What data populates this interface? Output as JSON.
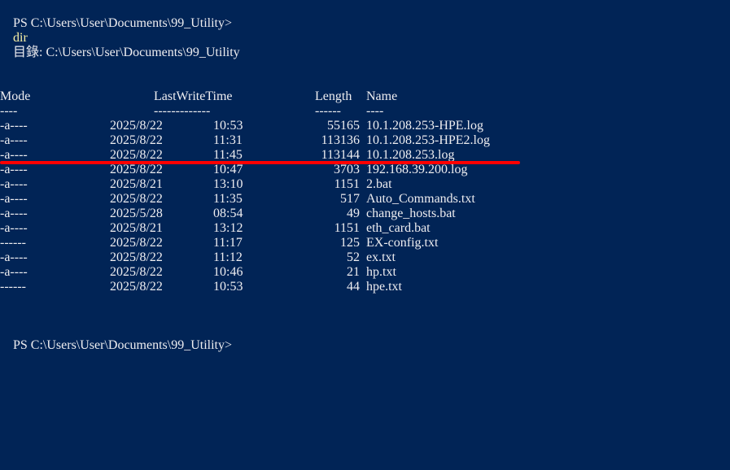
{
  "prompt_top": {
    "prefix": "PS C:\\Users\\User\\Documents\\99_Utility>",
    "command": "dir"
  },
  "directory_label": "    目錄: C:\\Users\\User\\Documents\\99_Utility",
  "headers": {
    "mode": "Mode",
    "last_write_time": "LastWriteTime",
    "length": "Length",
    "name": "Name"
  },
  "header_underline": {
    "mode": "----",
    "last_write_time": "-------------",
    "length": "------",
    "name": "----"
  },
  "files": [
    {
      "mode": "-a----",
      "date": "2025/8/22",
      "time": "10:53",
      "length": "55165",
      "name": "10.1.208.253-HPE.log"
    },
    {
      "mode": "-a----",
      "date": "2025/8/22",
      "time": "11:31",
      "length": "113136",
      "name": "10.1.208.253-HPE2.log"
    },
    {
      "mode": "-a----",
      "date": "2025/8/22",
      "time": "11:45",
      "length": "113144",
      "name": "10.1.208.253.log"
    },
    {
      "mode": "-a----",
      "date": "2025/8/22",
      "time": "10:47",
      "length": "3703",
      "name": "192.168.39.200.log"
    },
    {
      "mode": "-a----",
      "date": "2025/8/21",
      "time": "13:10",
      "length": "1151",
      "name": "2.bat"
    },
    {
      "mode": "-a----",
      "date": "2025/8/22",
      "time": "11:35",
      "length": "517",
      "name": "Auto_Commands.txt"
    },
    {
      "mode": "-a----",
      "date": "2025/5/28",
      "time": "08:54",
      "length": "49",
      "name": "change_hosts.bat"
    },
    {
      "mode": "-a----",
      "date": "2025/8/21",
      "time": "13:12",
      "length": "1151",
      "name": "eth_card.bat"
    },
    {
      "mode": "------",
      "date": "2025/8/22",
      "time": "11:17",
      "length": "125",
      "name": "EX-config.txt"
    },
    {
      "mode": "-a----",
      "date": "2025/8/22",
      "time": "11:12",
      "length": "52",
      "name": "ex.txt"
    },
    {
      "mode": "-a----",
      "date": "2025/8/22",
      "time": "10:46",
      "length": "21",
      "name": "hp.txt"
    },
    {
      "mode": "------",
      "date": "2025/8/22",
      "time": "10:53",
      "length": "44",
      "name": "hpe.txt"
    }
  ],
  "prompt_bottom": {
    "prefix": "PS C:\\Users\\User\\Documents\\99_Utility>"
  },
  "colors": {
    "background": "#012456",
    "foreground": "#eeedf0",
    "command": "#f9f1a5",
    "annotation_line": "#ff0000"
  }
}
